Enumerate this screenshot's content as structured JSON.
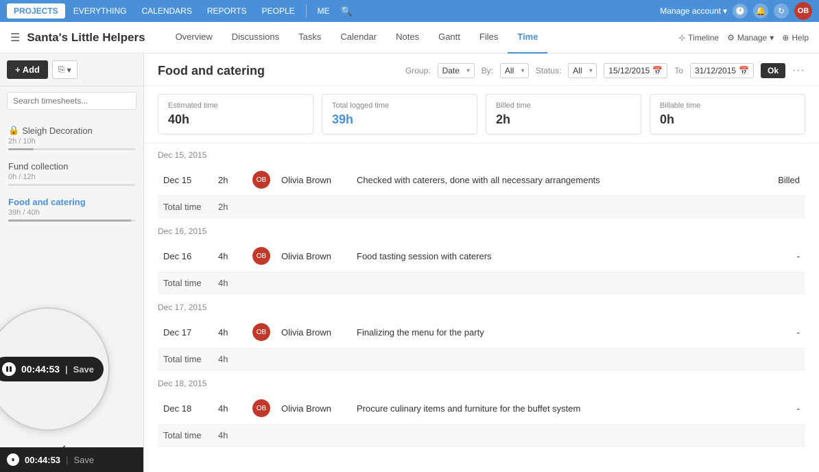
{
  "topNav": {
    "items": [
      {
        "label": "PROJECTS",
        "active": true
      },
      {
        "label": "EVERYTHING",
        "active": false
      },
      {
        "label": "CALENDARS",
        "active": false
      },
      {
        "label": "REPORTS",
        "active": false
      },
      {
        "label": "PEOPLE",
        "active": false
      }
    ],
    "me": "ME",
    "manageAccount": "Manage account",
    "icons": [
      "clock-icon",
      "bell-icon",
      "refresh-icon"
    ]
  },
  "secondNav": {
    "projectTitle": "Santa's Little Helpers",
    "tabs": [
      {
        "label": "Overview"
      },
      {
        "label": "Discussions"
      },
      {
        "label": "Tasks"
      },
      {
        "label": "Calendar"
      },
      {
        "label": "Notes"
      },
      {
        "label": "Gantt"
      },
      {
        "label": "Files"
      },
      {
        "label": "Time",
        "active": true
      }
    ],
    "timelineLabel": "Timeline",
    "manageLabel": "Manage",
    "helpLabel": "Help"
  },
  "sidebar": {
    "addLabel": "+ Add",
    "searchPlaceholder": "Search timesheets...",
    "items": [
      {
        "name": "Sleigh Decoration",
        "icon": "lock",
        "meta": "2h / 10h",
        "progress": 20,
        "active": false
      },
      {
        "name": "Fund collection",
        "icon": null,
        "meta": "0h / 12h",
        "progress": 0,
        "active": false
      },
      {
        "name": "Food and catering",
        "icon": null,
        "meta": "39h / 40h",
        "progress": 97,
        "active": true
      }
    ],
    "timer": {
      "time": "00:44:53",
      "saveLabel": "Save"
    }
  },
  "content": {
    "title": "Food and catering",
    "filters": {
      "groupLabel": "Group:",
      "groupValue": "Date",
      "byLabel": "By:",
      "byValue": "All",
      "statusLabel": "Status:",
      "statusValue": "All",
      "fromDate": "15/12/2015",
      "toDate": "31/12/2015",
      "toLabel": "To",
      "okLabel": "Ok"
    },
    "stats": [
      {
        "label": "Estimated time",
        "value": "40h"
      },
      {
        "label": "Total logged time",
        "value": "39h",
        "blue": true
      },
      {
        "label": "Billed time",
        "value": "2h"
      },
      {
        "label": "Billable time",
        "value": "0h"
      }
    ],
    "days": [
      {
        "header": "Dec 15, 2015",
        "entries": [
          {
            "date": "Dec 15",
            "time": "2h",
            "user": "Olivia Brown",
            "description": "Checked with caterers, done with all necessary arrangements",
            "status": "Billed"
          }
        ],
        "totalLabel": "Total time",
        "totalValue": "2h"
      },
      {
        "header": "Dec 16, 2015",
        "entries": [
          {
            "date": "Dec 16",
            "time": "4h",
            "user": "Olivia Brown",
            "description": "Food tasting session with caterers",
            "status": "-"
          }
        ],
        "totalLabel": "Total time",
        "totalValue": "4h"
      },
      {
        "header": "Dec 17, 2015",
        "entries": [
          {
            "date": "Dec 17",
            "time": "4h",
            "user": "Olivia Brown",
            "description": "Finalizing the menu for the party",
            "status": "-"
          }
        ],
        "totalLabel": "Total time",
        "totalValue": "4h"
      },
      {
        "header": "Dec 18, 2015",
        "entries": [
          {
            "date": "Dec 18",
            "time": "4h",
            "user": "Olivia Brown",
            "description": "Procure culinary items and furniture for the buffet system",
            "status": "-"
          }
        ],
        "totalLabel": "Total time",
        "totalValue": "4h"
      }
    ]
  }
}
